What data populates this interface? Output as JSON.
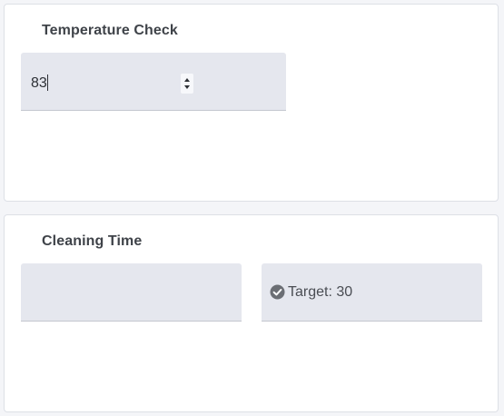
{
  "temperature_check": {
    "title": "Temperature Check",
    "input_value": "83"
  },
  "cleaning_time": {
    "title": "Cleaning Time",
    "input_value": "",
    "target_label": "Target: 30",
    "target_icon": "check-circle-icon"
  },
  "colors": {
    "page_background": "#f4f5f8",
    "card_background": "#ffffff",
    "field_background": "#e5e7ee",
    "icon_gray": "#6b6e74"
  }
}
